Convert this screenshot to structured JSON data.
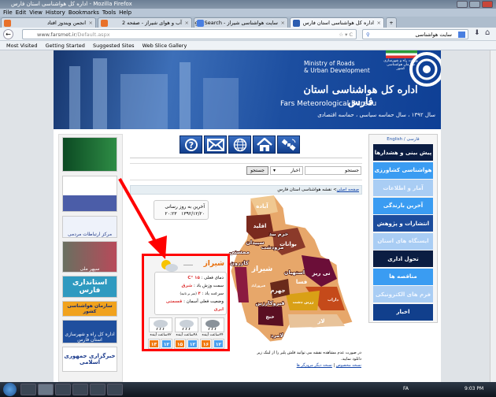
{
  "window": {
    "title": "اداره کل هواشناسی استان فارس - Mozilla Firefox"
  },
  "menu": [
    "File",
    "Edit",
    "View",
    "History",
    "Bookmarks",
    "Tools",
    "Help"
  ],
  "tabs": [
    {
      "label": "انجمن ویندوز افتاد",
      "active": false
    },
    {
      "label": "آب و هوای شیراز - صفحه 2",
      "active": false
    },
    {
      "label": "سایت هواشناسی شیراز - Google Search",
      "active": false
    },
    {
      "label": "اداره کل هواشناسی استان فارس",
      "active": true
    }
  ],
  "navbar": {
    "url_host": "www.farsmet.ir",
    "url_path": "/Default.aspx",
    "search_value": "سایت هواشناسی"
  },
  "bookmarks": [
    "Most Visited",
    "Getting Started",
    "Suggested Sites",
    "Web Slice Gallery"
  ],
  "header": {
    "ministry_line1": "Ministry of Roads",
    "ministry_line2": "& Urban Development",
    "title_fa": "اداره کل هواشناسی استان فارس",
    "title_en": "Fars Meteorological Bureau",
    "slogan": "سال ۱۳۹۲ ، سال حماسه سیاسی ، حماسه اقتصادی",
    "logo_text1": "وزارت راه و شهرسازی",
    "logo_text2": "سازمان هواشناسی کشور"
  },
  "banners": [
    "",
    "",
    "مرکز ارتباطات مردمی",
    "سپهر ملی",
    "استانداری فارس",
    "سازمان هواشناسی کشور",
    "اداره کل راه و شهرسازی استان فارس",
    "خبرگزاری جمهوری اسلامی"
  ],
  "icons": [
    "help-icon",
    "mail-icon",
    "globe-icon",
    "home-icon",
    "satellite-icon"
  ],
  "search": {
    "placeholder": "جستجو",
    "category": "اخبار",
    "button": "جستجو"
  },
  "breadcrumb": {
    "home": "صفحه اصلی",
    "sep": ">",
    "current": "نقشه هواشناسی استان فارس"
  },
  "update": {
    "label": "آخرین به روز رسانی",
    "date": "۱۳۹۲/۱۲/۲۰",
    "time": "۲۰:۲۳"
  },
  "weather": {
    "city": "شیراز",
    "temp_label": "دمای فعلی :",
    "temp": "۱۵ °C",
    "wind_dir_label": "سمت وزش باد :",
    "wind_dir": "شرق",
    "wind_speed_label": "سرعت باد :",
    "wind_speed": "۴",
    "wind_unit": "(متر بر ثانیه)",
    "sky_label": "وضعیت فعلی آسمان :",
    "sky": "قسمتی ابری",
    "forecasts": [
      {
        "label": "۲۴ساعت آینده",
        "max": "۱۶",
        "min": "۱۲"
      },
      {
        "label": "۴۸ساعت آینده",
        "max": "۱۵",
        "min": "۱۲"
      },
      {
        "label": "۷۲ساعت آینده",
        "max": "۱۳",
        "min": "۱۲"
      }
    ]
  },
  "map_cities": [
    "آباده",
    "اقلید",
    "بوانات",
    "نی ریز",
    "شیراز",
    "فسا",
    "جهرم",
    "داراب",
    "لار",
    "کازرون",
    "ممسنی",
    "زرین دشت",
    "فیروزآباد",
    "خنج",
    "استهبان",
    "مرودشت",
    "سپیدان",
    "خرم بید",
    "لامرد",
    "قیروکارزین"
  ],
  "map_note": "در صورت عدم مشاهده نقشه می توانید فلش پلیر را از لینک زیر دانلود نمایید.",
  "map_links": [
    "نسخه مخصوص",
    "نسخه دیگر مرورگر ها"
  ],
  "language": {
    "fa": "فارسی",
    "sep": "/",
    "en": "English"
  },
  "right_menu": [
    {
      "label": "پیش بینی و هشدارها",
      "color": "#0b1d42"
    },
    {
      "label": "هواشناسی کشاورزی",
      "color": "#3a9cf2"
    },
    {
      "label": "آمار و اطلاعات",
      "color": "#a9cdf4"
    },
    {
      "label": "آخرین بارندگی",
      "color": "#3a9cf2"
    },
    {
      "label": "انتشارات و پژوهش",
      "color": "#1c4c9c"
    },
    {
      "label": "ایستگاه های استان",
      "color": "#a9cdf4"
    },
    {
      "label": "تحول اداری",
      "color": "#0b1d42"
    },
    {
      "label": "مناقصه ها",
      "color": "#3a9cf2"
    },
    {
      "label": "فرم های الکترونیکی",
      "color": "#a9cdf4"
    },
    {
      "label": "اخبار",
      "color": "#113f8c"
    }
  ],
  "taskbar": {
    "lang": "FA",
    "clock": "9:03 PM"
  }
}
